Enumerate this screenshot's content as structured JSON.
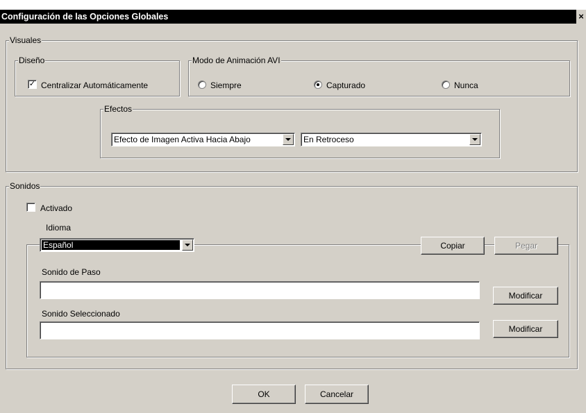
{
  "window": {
    "title": "Configuración de las Opciones Globales",
    "close_glyph": "×"
  },
  "visuales": {
    "legend": "Visuales",
    "diseno": {
      "legend": "Diseño",
      "centralizar_label": "Centralizar Automáticamente",
      "centralizar_checked": true,
      "check_glyph": "✓"
    },
    "modo_animacion": {
      "legend": "Modo de Animación AVI",
      "options": [
        "Siempre",
        "Capturado",
        "Nunca"
      ],
      "selected": "Capturado"
    },
    "efectos": {
      "legend": "Efectos",
      "efecto_value": "Efecto de Imagen Activa Hacia Abajo",
      "retroceso_value": "En Retroceso"
    }
  },
  "sonidos": {
    "legend": "Sonidos",
    "activado_label": "Activado",
    "activado_checked": false,
    "idioma_label": "Idioma",
    "idioma_value": "Español",
    "copiar_label": "Copiar",
    "pegar_label": "Pegar",
    "sonido_paso_label": "Sonido de Paso",
    "sonido_paso_value": "",
    "sonido_seleccionado_label": "Sonido Seleccionado",
    "sonido_seleccionado_value": "",
    "modificar_label": "Modificar"
  },
  "footer": {
    "ok_label": "OK",
    "cancelar_label": "Cancelar"
  }
}
